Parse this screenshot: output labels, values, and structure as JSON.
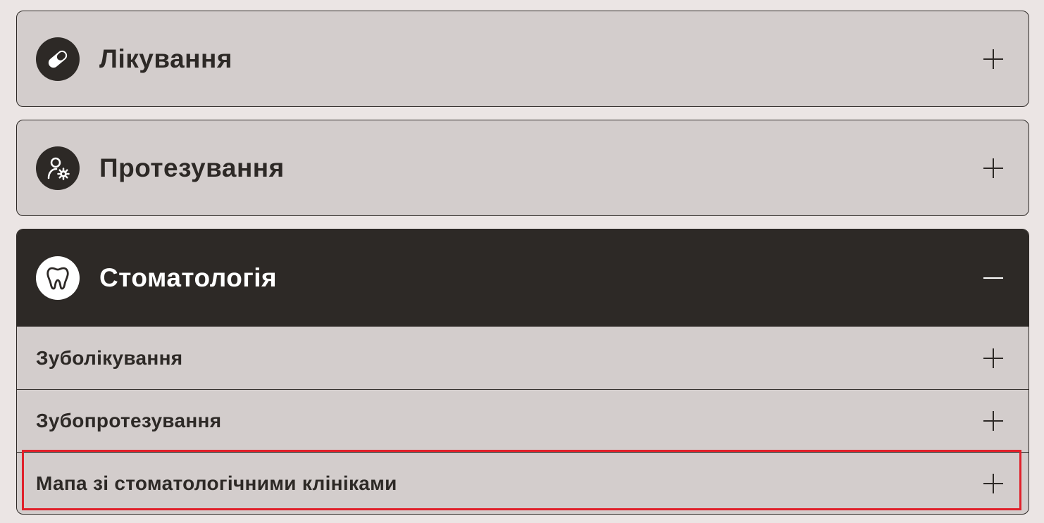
{
  "accordion": {
    "sections": [
      {
        "title": "Лікування",
        "icon": "pill-icon",
        "expanded": false
      },
      {
        "title": "Протезування",
        "icon": "person-gear-icon",
        "expanded": false
      },
      {
        "title": "Стоматологія",
        "icon": "tooth-icon",
        "expanded": true,
        "items": [
          {
            "label": "Зуболікування"
          },
          {
            "label": "Зубопротезування"
          },
          {
            "label": "Мапа зі стоматологічними клініками",
            "highlighted": true
          }
        ]
      }
    ]
  },
  "colors": {
    "page_bg": "#ebe5e4",
    "panel_bg": "#d3cdcc",
    "dark": "#2d2926",
    "highlight": "#e0202a"
  }
}
